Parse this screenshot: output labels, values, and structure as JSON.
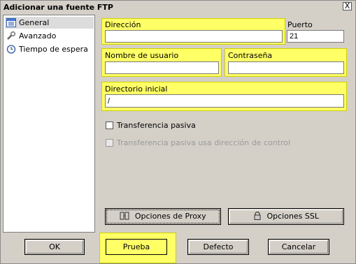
{
  "window": {
    "title": "Adicionar una fuente FTP",
    "close_glyph": "X"
  },
  "sidebar": {
    "items": [
      {
        "label": "General",
        "icon": "list-icon",
        "selected": true
      },
      {
        "label": "Avanzado",
        "icon": "wrench-icon",
        "selected": false
      },
      {
        "label": "Tiempo de espera",
        "icon": "clock-icon",
        "selected": false
      }
    ]
  },
  "form": {
    "direccion_label": "Dirección",
    "direccion_value": "",
    "puerto_label": "Puerto",
    "puerto_value": "21",
    "usuario_label": "Nombre de usuario",
    "usuario_value": "",
    "contrasena_label": "Contraseña",
    "contrasena_value": "",
    "directorio_label": "Directorio inicial",
    "directorio_value": "/",
    "pasiva_label": "Transferencia pasiva",
    "pasiva_checked": false,
    "pasiva_control_label": "Transferencia pasiva usa dirección de control",
    "pasiva_control_checked": false
  },
  "buttons": {
    "proxy": "Opciones de Proxy",
    "ssl": "Opciones SSL",
    "ok": "OK",
    "prueba": "Prueba",
    "defecto": "Defecto",
    "cancelar": "Cancelar"
  },
  "colors": {
    "highlight": "#ffff66",
    "dialog_bg": "#d4d0c8"
  }
}
